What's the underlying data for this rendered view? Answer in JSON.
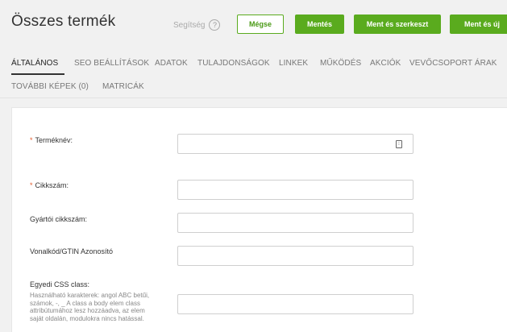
{
  "header": {
    "title": "Összes termék",
    "help_label": "Segítség",
    "help_icon": "?"
  },
  "toolbar": {
    "cancel_label": "Mégse",
    "save_label": "Mentés",
    "save_edit_label": "Ment és szerkeszt",
    "save_new_label": "Ment és új"
  },
  "tabs": [
    {
      "label": "ÁLTALÁNOS",
      "active": true
    },
    {
      "label": "SEO BEÁLLÍTÁSOK"
    },
    {
      "label": "ADATOK"
    },
    {
      "label": "TULAJDONSÁGOK"
    },
    {
      "label": "LINKEK"
    },
    {
      "label": "MŰKÖDÉS"
    },
    {
      "label": "AKCIÓK"
    },
    {
      "label": "VEVŐCSOPORT ÁRAK"
    },
    {
      "label": "TOVÁBBI KÉPEK (0)"
    },
    {
      "label": "MATRICÁK"
    }
  ],
  "form": {
    "required_mark": "*",
    "product_name_label": "Terméknév:",
    "product_name_value": "",
    "sku_label": "Cikkszám:",
    "sku_value": "",
    "manufacturer_sku_label": "Gyártói cikkszám:",
    "manufacturer_sku_value": "",
    "barcode_label": "Vonalkód/GTIN Azonosító",
    "barcode_value": "",
    "css_class_label": "Egyedi CSS class:",
    "css_class_hint": "Használható karakterek: angol ABC betűi, számok, -, _ A class a body elem class attribútumához lesz hozzáadva, az elem saját oldalán, modulokra nincs hatással.",
    "css_class_value": "",
    "lang_icon": "⁝"
  },
  "colors": {
    "accent": "#5aab1e",
    "required": "#e25c2f",
    "background": "#f1f1f1"
  }
}
